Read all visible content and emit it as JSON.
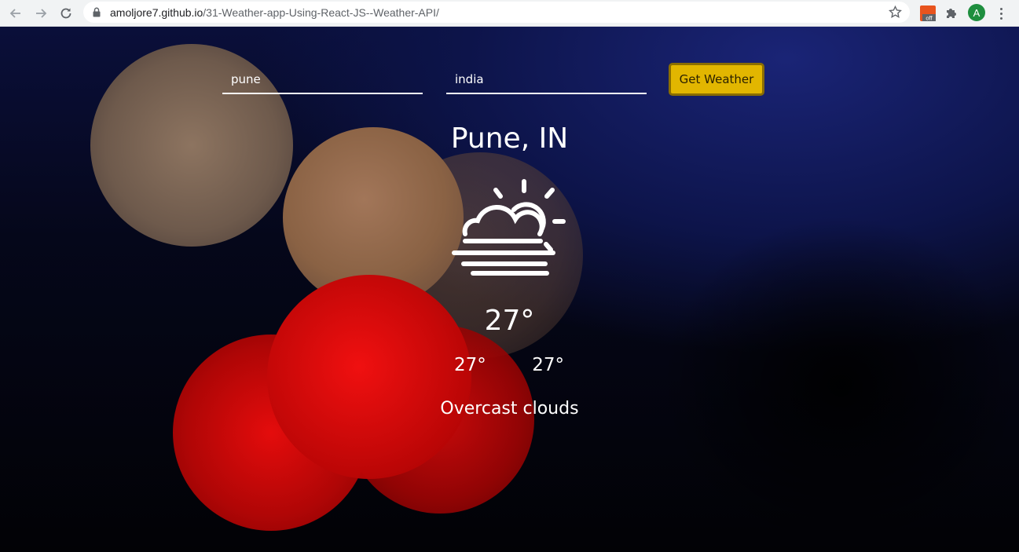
{
  "browser": {
    "url_host": "amoljore7.github.io",
    "url_path": "/31-Weather-app-Using-React-JS--Weather-API/",
    "avatar_letter": "A",
    "ext_badge": "off"
  },
  "form": {
    "city_value": "pune",
    "country_value": "india",
    "button_label": "Get Weather"
  },
  "weather": {
    "location": "Pune, IN",
    "icon": "fog-partly-sunny-icon",
    "temp": "27°",
    "temp_min": "27°",
    "temp_max": "27°",
    "description": "Overcast clouds"
  },
  "colors": {
    "button_bg": "#e2b600",
    "text": "#ffffff"
  }
}
